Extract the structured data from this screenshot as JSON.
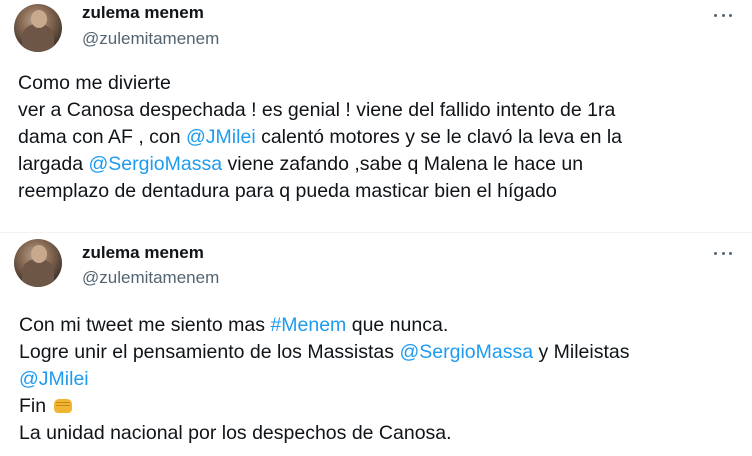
{
  "tweets": [
    {
      "author_name": "zulema menem",
      "handle": "@zulemitamenem",
      "lines": [
        [
          {
            "t": "Como me divierte"
          }
        ],
        [
          {
            "t": "ver a Canosa despechada ! es genial ! viene del fallido intento de 1ra"
          }
        ],
        [
          {
            "t": "dama con AF , con "
          },
          {
            "t": "@JMilei",
            "link": true
          },
          {
            "t": " calentó motores y se le clavó la leva en la"
          }
        ],
        [
          {
            "t": "largada "
          },
          {
            "t": "@SergioMassa",
            "link": true
          },
          {
            "t": " viene zafando ,sabe q Malena le hace un"
          }
        ],
        [
          {
            "t": "reemplazo de dentadura para q pueda masticar bien el hígado"
          }
        ]
      ]
    },
    {
      "author_name": "zulema menem",
      "handle": "@zulemitamenem",
      "lines": [
        [
          {
            "t": "Con mi tweet me siento mas "
          },
          {
            "t": "#Menem",
            "link": true
          },
          {
            "t": " que nunca."
          }
        ],
        [
          {
            "t": "Logre unir el pensamiento de los Massistas "
          },
          {
            "t": "@SergioMassa",
            "link": true
          },
          {
            "t": " y Mileistas"
          }
        ],
        [
          {
            "t": "@JMilei",
            "link": true
          }
        ],
        [
          {
            "t": "Fin "
          },
          {
            "emoji": "fist-icon"
          }
        ],
        [
          {
            "t": "La unidad nacional por los despechos de Canosa."
          }
        ]
      ]
    }
  ],
  "colors": {
    "text": "#0f1419",
    "secondary": "#536471",
    "link": "#1d9bf0"
  },
  "icons": {
    "more": "more-horizontal-icon",
    "emoji": "oncoming-fist-emoji"
  }
}
